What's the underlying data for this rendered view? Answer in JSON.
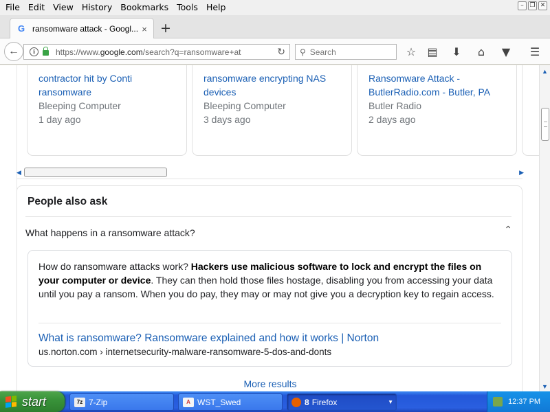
{
  "menu": [
    "File",
    "Edit",
    "View",
    "History",
    "Bookmarks",
    "Tools",
    "Help"
  ],
  "window_controls": [
    "–",
    "❐",
    "✕"
  ],
  "tab": {
    "title": "ransomware attack - Googl...",
    "favicon": "G",
    "close": "×"
  },
  "new_tab": "+",
  "url": {
    "prefix": "https://www.",
    "domain": "google.com",
    "path": "/search?q=ransomware+at"
  },
  "search": {
    "placeholder": "Search"
  },
  "toolbar_icons": [
    "star-icon",
    "reading-list-icon",
    "download-icon",
    "home-icon",
    "pocket-icon",
    "menu-icon"
  ],
  "cards": [
    {
      "headline": "contractor hit by Conti ransomware",
      "source": "Bleeping Computer",
      "age": "1 day ago"
    },
    {
      "headline": "ransomware encrypting NAS devices",
      "source": "Bleeping Computer",
      "age": "3 days ago"
    },
    {
      "headline": "Ransomware Attack - ButlerRadio.com - Butler, PA",
      "source": "Butler Radio",
      "age": "2 days ago"
    }
  ],
  "paa": {
    "title": "People also ask",
    "question": "What happens in a ransomware attack?",
    "answer_intro": "How do ransomware attacks work? ",
    "answer_bold": "Hackers use malicious software to lock and encrypt the files on your computer or device",
    "answer_rest": ". They can then hold those files hostage, disabling you from accessing your data until you pay a ransom. When you do pay, they may or may not give you a decryption key to regain access.",
    "link_title": "What is ransomware? Ransomware explained and how it works | Norton",
    "link_cite": "us.norton.com › internetsecurity-malware-ransomware-5-dos-and-donts",
    "more": "More results"
  },
  "taskbar": {
    "start": "start",
    "tasks": [
      {
        "icon": "7z",
        "label": "7-Zip"
      },
      {
        "icon": "A",
        "label": "WST_Swed"
      },
      {
        "icon": "",
        "count": "8",
        "label": "Firefox"
      }
    ],
    "clock": "12:37 PM"
  }
}
